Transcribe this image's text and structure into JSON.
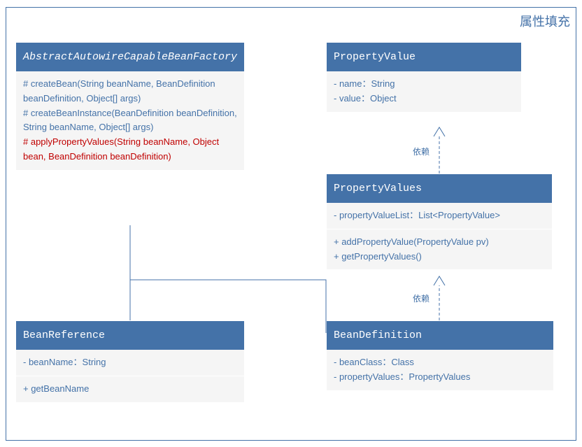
{
  "diagram": {
    "title": "属性填充",
    "classes": {
      "abstractFactory": {
        "name": "AbstractAutowireCapableBeanFactory",
        "nameStyle": "italic",
        "methods": [
          {
            "text": "# createBean(String beanName, BeanDefinition beanDefinition, Object[] args)",
            "highlight": false
          },
          {
            "text": "# createBeanInstance(BeanDefinition beanDefinition, String beanName, Object[] args)",
            "highlight": false
          },
          {
            "text": "# applyPropertyValues(String beanName, Object bean, BeanDefinition beanDefinition)",
            "highlight": true
          }
        ]
      },
      "propertyValue": {
        "name": "PropertyValue",
        "attributes": [
          "- name：String",
          "- value：Object"
        ]
      },
      "propertyValues": {
        "name": "PropertyValues",
        "attributes": [
          "- propertyValueList：List<PropertyValue>"
        ],
        "methods": [
          "+ addPropertyValue(PropertyValue pv)",
          "+ getPropertyValues()"
        ]
      },
      "beanReference": {
        "name": "BeanReference",
        "attributes": [
          "- beanName：String"
        ],
        "methods": [
          "+ getBeanName"
        ]
      },
      "beanDefinition": {
        "name": "BeanDefinition",
        "attributes": [
          "- beanClass：Class",
          "- propertyValues：PropertyValues"
        ]
      }
    },
    "relations": {
      "dep1": "依赖",
      "dep2": "依赖"
    }
  },
  "chart_data": {
    "type": "uml_class_diagram",
    "title": "属性填充",
    "classes": [
      {
        "name": "AbstractAutowireCapableBeanFactory",
        "abstract": true,
        "operations": [
          "# createBean(String beanName, BeanDefinition beanDefinition, Object[] args)",
          "# createBeanInstance(BeanDefinition beanDefinition, String beanName, Object[] args)",
          "# applyPropertyValues(String beanName, Object bean, BeanDefinition beanDefinition)"
        ]
      },
      {
        "name": "PropertyValue",
        "attributes": [
          "- name : String",
          "- value : Object"
        ]
      },
      {
        "name": "PropertyValues",
        "attributes": [
          "- propertyValueList : List<PropertyValue>"
        ],
        "operations": [
          "+ addPropertyValue(PropertyValue pv)",
          "+ getPropertyValues()"
        ]
      },
      {
        "name": "BeanReference",
        "attributes": [
          "- beanName : String"
        ],
        "operations": [
          "+ getBeanName"
        ]
      },
      {
        "name": "BeanDefinition",
        "attributes": [
          "- beanClass : Class",
          "- propertyValues : PropertyValues"
        ]
      }
    ],
    "relationships": [
      {
        "from": "AbstractAutowireCapableBeanFactory",
        "to": "BeanReference",
        "type": "association"
      },
      {
        "from": "AbstractAutowireCapableBeanFactory",
        "to": "BeanDefinition",
        "type": "association"
      },
      {
        "from": "PropertyValues",
        "to": "PropertyValue",
        "type": "dependency",
        "label": "依赖"
      },
      {
        "from": "BeanDefinition",
        "to": "PropertyValues",
        "type": "dependency",
        "label": "依赖"
      }
    ]
  }
}
